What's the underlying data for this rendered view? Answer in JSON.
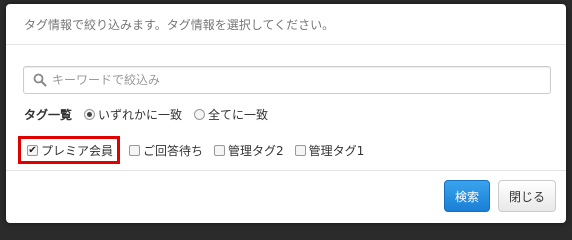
{
  "header": {
    "instruction": "タグ情報で絞り込みます。タグ情報を選択してください。"
  },
  "search": {
    "placeholder": "キーワードで絞込み",
    "value": ""
  },
  "tag_list": {
    "label": "タグ一覧",
    "match_options": [
      {
        "label": "いずれかに一致",
        "selected": true
      },
      {
        "label": "全てに一致",
        "selected": false
      }
    ]
  },
  "tags": [
    {
      "label": "プレミア会員",
      "checked": true
    },
    {
      "label": "ご回答待ち",
      "checked": false
    },
    {
      "label": "管理タグ2",
      "checked": false
    },
    {
      "label": "管理タグ1",
      "checked": false
    }
  ],
  "footer": {
    "search_button": "検索",
    "close_button": "閉じる"
  },
  "colors": {
    "primary": "#2a8fe0",
    "highlight": "#e00000"
  }
}
